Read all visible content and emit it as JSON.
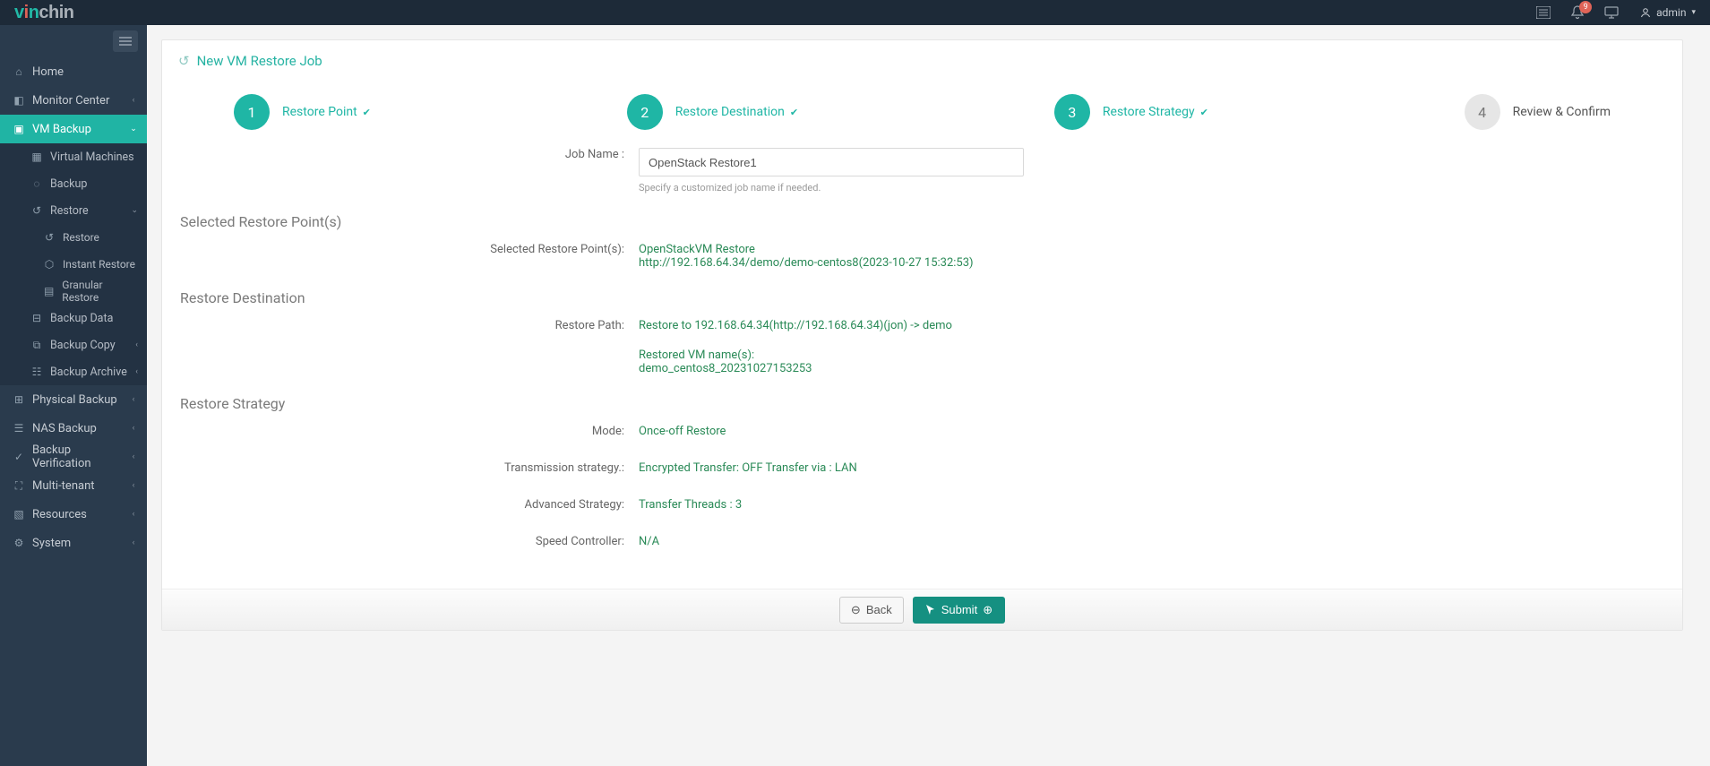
{
  "brand": {
    "part1": "v",
    "part2": "i",
    "part3": "n",
    "part4": "chin"
  },
  "header": {
    "notification_count": "9",
    "user_label": "admin"
  },
  "sidebar": {
    "items": [
      {
        "label": "Home"
      },
      {
        "label": "Monitor Center"
      },
      {
        "label": "VM Backup"
      },
      {
        "label": "Physical Backup"
      },
      {
        "label": "NAS Backup"
      },
      {
        "label": "Backup Verification"
      },
      {
        "label": "Multi-tenant"
      },
      {
        "label": "Resources"
      },
      {
        "label": "System"
      }
    ],
    "vm_backup_children": [
      {
        "label": "Virtual Machines"
      },
      {
        "label": "Backup"
      },
      {
        "label": "Restore"
      },
      {
        "label": "Backup Data"
      },
      {
        "label": "Backup Copy"
      },
      {
        "label": "Backup Archive"
      }
    ],
    "restore_children": [
      {
        "label": "Restore"
      },
      {
        "label": "Instant Restore"
      },
      {
        "label": "Granular Restore"
      }
    ]
  },
  "page": {
    "title": "New VM Restore Job",
    "steps": [
      {
        "num": "1",
        "label": "Restore Point"
      },
      {
        "num": "2",
        "label": "Restore Destination"
      },
      {
        "num": "3",
        "label": "Restore Strategy"
      },
      {
        "num": "4",
        "label": "Review & Confirm"
      }
    ],
    "job_name_label": "Job Name :",
    "job_name_value": "OpenStack Restore1",
    "job_name_hint": "Specify a customized job name if needed.",
    "sections": {
      "restore_point": {
        "title": "Selected Restore Point(s)",
        "label": "Selected Restore Point(s):",
        "value_line1": "OpenStackVM Restore",
        "value_line2": "http://192.168.64.34/demo/demo-centos8(2023-10-27 15:32:53)"
      },
      "restore_destination": {
        "title": "Restore Destination",
        "path_label": "Restore Path:",
        "path_value": "Restore to 192.168.64.34(http://192.168.64.34)(jon) -> demo",
        "names_label": "Restored VM name(s):",
        "names_value": "demo_centos8_20231027153253"
      },
      "restore_strategy": {
        "title": "Restore Strategy",
        "mode_label": "Mode:",
        "mode_value": "Once-off Restore",
        "trans_label": "Transmission strategy.:",
        "trans_value": "Encrypted Transfer: OFF Transfer via : LAN",
        "adv_label": "Advanced Strategy:",
        "adv_value": "Transfer Threads : 3",
        "speed_label": "Speed Controller:",
        "speed_value": "N/A"
      }
    },
    "buttons": {
      "back": "Back",
      "submit": "Submit"
    }
  }
}
